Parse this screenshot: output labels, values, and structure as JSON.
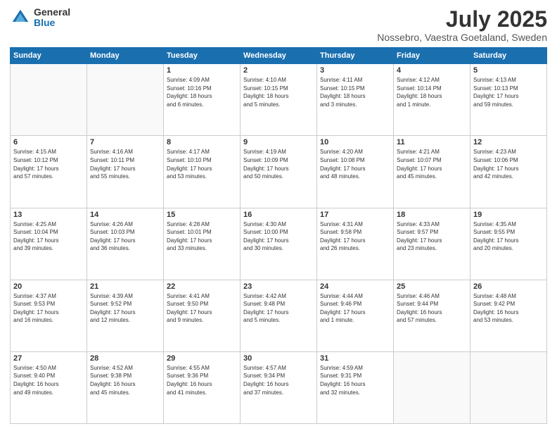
{
  "header": {
    "logo_general": "General",
    "logo_blue": "Blue",
    "title": "July 2025",
    "subtitle": "Nossebro, Vaestra Goetaland, Sweden"
  },
  "days_of_week": [
    "Sunday",
    "Monday",
    "Tuesday",
    "Wednesday",
    "Thursday",
    "Friday",
    "Saturday"
  ],
  "weeks": [
    [
      {
        "day": "",
        "info": ""
      },
      {
        "day": "",
        "info": ""
      },
      {
        "day": "1",
        "info": "Sunrise: 4:09 AM\nSunset: 10:16 PM\nDaylight: 18 hours\nand 6 minutes."
      },
      {
        "day": "2",
        "info": "Sunrise: 4:10 AM\nSunset: 10:15 PM\nDaylight: 18 hours\nand 5 minutes."
      },
      {
        "day": "3",
        "info": "Sunrise: 4:11 AM\nSunset: 10:15 PM\nDaylight: 18 hours\nand 3 minutes."
      },
      {
        "day": "4",
        "info": "Sunrise: 4:12 AM\nSunset: 10:14 PM\nDaylight: 18 hours\nand 1 minute."
      },
      {
        "day": "5",
        "info": "Sunrise: 4:13 AM\nSunset: 10:13 PM\nDaylight: 17 hours\nand 59 minutes."
      }
    ],
    [
      {
        "day": "6",
        "info": "Sunrise: 4:15 AM\nSunset: 10:12 PM\nDaylight: 17 hours\nand 57 minutes."
      },
      {
        "day": "7",
        "info": "Sunrise: 4:16 AM\nSunset: 10:11 PM\nDaylight: 17 hours\nand 55 minutes."
      },
      {
        "day": "8",
        "info": "Sunrise: 4:17 AM\nSunset: 10:10 PM\nDaylight: 17 hours\nand 53 minutes."
      },
      {
        "day": "9",
        "info": "Sunrise: 4:19 AM\nSunset: 10:09 PM\nDaylight: 17 hours\nand 50 minutes."
      },
      {
        "day": "10",
        "info": "Sunrise: 4:20 AM\nSunset: 10:08 PM\nDaylight: 17 hours\nand 48 minutes."
      },
      {
        "day": "11",
        "info": "Sunrise: 4:21 AM\nSunset: 10:07 PM\nDaylight: 17 hours\nand 45 minutes."
      },
      {
        "day": "12",
        "info": "Sunrise: 4:23 AM\nSunset: 10:06 PM\nDaylight: 17 hours\nand 42 minutes."
      }
    ],
    [
      {
        "day": "13",
        "info": "Sunrise: 4:25 AM\nSunset: 10:04 PM\nDaylight: 17 hours\nand 39 minutes."
      },
      {
        "day": "14",
        "info": "Sunrise: 4:26 AM\nSunset: 10:03 PM\nDaylight: 17 hours\nand 36 minutes."
      },
      {
        "day": "15",
        "info": "Sunrise: 4:28 AM\nSunset: 10:01 PM\nDaylight: 17 hours\nand 33 minutes."
      },
      {
        "day": "16",
        "info": "Sunrise: 4:30 AM\nSunset: 10:00 PM\nDaylight: 17 hours\nand 30 minutes."
      },
      {
        "day": "17",
        "info": "Sunrise: 4:31 AM\nSunset: 9:58 PM\nDaylight: 17 hours\nand 26 minutes."
      },
      {
        "day": "18",
        "info": "Sunrise: 4:33 AM\nSunset: 9:57 PM\nDaylight: 17 hours\nand 23 minutes."
      },
      {
        "day": "19",
        "info": "Sunrise: 4:35 AM\nSunset: 9:55 PM\nDaylight: 17 hours\nand 20 minutes."
      }
    ],
    [
      {
        "day": "20",
        "info": "Sunrise: 4:37 AM\nSunset: 9:53 PM\nDaylight: 17 hours\nand 16 minutes."
      },
      {
        "day": "21",
        "info": "Sunrise: 4:39 AM\nSunset: 9:52 PM\nDaylight: 17 hours\nand 12 minutes."
      },
      {
        "day": "22",
        "info": "Sunrise: 4:41 AM\nSunset: 9:50 PM\nDaylight: 17 hours\nand 9 minutes."
      },
      {
        "day": "23",
        "info": "Sunrise: 4:42 AM\nSunset: 9:48 PM\nDaylight: 17 hours\nand 5 minutes."
      },
      {
        "day": "24",
        "info": "Sunrise: 4:44 AM\nSunset: 9:46 PM\nDaylight: 17 hours\nand 1 minute."
      },
      {
        "day": "25",
        "info": "Sunrise: 4:46 AM\nSunset: 9:44 PM\nDaylight: 16 hours\nand 57 minutes."
      },
      {
        "day": "26",
        "info": "Sunrise: 4:48 AM\nSunset: 9:42 PM\nDaylight: 16 hours\nand 53 minutes."
      }
    ],
    [
      {
        "day": "27",
        "info": "Sunrise: 4:50 AM\nSunset: 9:40 PM\nDaylight: 16 hours\nand 49 minutes."
      },
      {
        "day": "28",
        "info": "Sunrise: 4:52 AM\nSunset: 9:38 PM\nDaylight: 16 hours\nand 45 minutes."
      },
      {
        "day": "29",
        "info": "Sunrise: 4:55 AM\nSunset: 9:36 PM\nDaylight: 16 hours\nand 41 minutes."
      },
      {
        "day": "30",
        "info": "Sunrise: 4:57 AM\nSunset: 9:34 PM\nDaylight: 16 hours\nand 37 minutes."
      },
      {
        "day": "31",
        "info": "Sunrise: 4:59 AM\nSunset: 9:31 PM\nDaylight: 16 hours\nand 32 minutes."
      },
      {
        "day": "",
        "info": ""
      },
      {
        "day": "",
        "info": ""
      }
    ]
  ]
}
